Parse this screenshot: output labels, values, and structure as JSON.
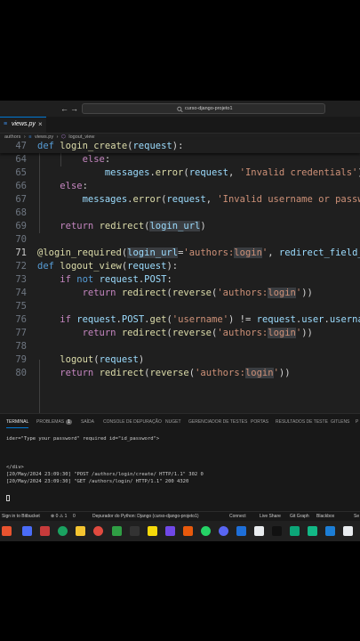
{
  "titlebar": {
    "back": "←",
    "forward": "→",
    "search_text": "curso-django-projeto1"
  },
  "tab": {
    "icon": "python-icon",
    "name": "views.py",
    "close": "×"
  },
  "breadcrumb": {
    "folder": "authors",
    "sep": "›",
    "file": "views.py",
    "symbol": "logout_view"
  },
  "editor": {
    "line_numbers": [
      "47",
      "64",
      "65",
      "66",
      "67",
      "68",
      "69",
      "70",
      "71",
      "72",
      "73",
      "74",
      "75",
      "76",
      "77",
      "78",
      "79",
      "80"
    ]
  },
  "panel": {
    "tabs": [
      "TERMINAL",
      "PROBLEMAS",
      "SAÍDA",
      "CONSOLE DE DEPURAÇÃO",
      "NUGET",
      "GERENCIADOR DE TESTES",
      "PORTAS",
      "RESULTADOS DE TESTE",
      "GITLENS",
      "P"
    ],
    "problems_count": "1",
    "terminal_lines": [
      "ider=\"Type your password\" required id=\"id_password\">",
      "",
      "",
      "</div>",
      "[20/May/2024 23:09:30] \"POST /authors/login/create/ HTTP/1.1\" 302 0",
      "[20/May/2024 23:09:30] \"GET /authors/login/ HTTP/1.1\" 200 4320"
    ]
  },
  "statusbar": {
    "bitbucket": "Sign in to Bitbucket",
    "problems": "⊗ 0 ⚠ 1",
    "ports": "0",
    "debugger": "Depurador do Python: Django (curso-django-projeto1)",
    "connect": "Connect",
    "live_share": "Live Share",
    "git_graph": "Git Graph",
    "blackbox": "Blackbox",
    "more": "Se"
  },
  "colors": {
    "accent": "#0078d4",
    "keyword": "#c586c0",
    "function": "#dcdcaa",
    "string": "#ce9178"
  }
}
